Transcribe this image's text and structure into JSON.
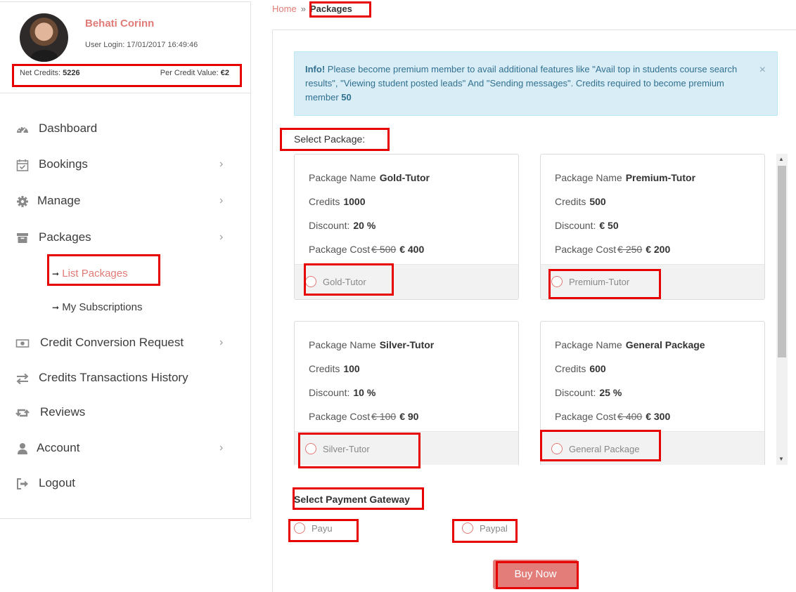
{
  "colors": {
    "accent": "#e07b77",
    "annotation": "#e60000",
    "alert_bg": "#d9edf7",
    "alert_text": "#31708f"
  },
  "profile": {
    "name": "Behati Corinn",
    "login": "User Login: 17/01/2017 16:49:46",
    "net_credits_label": "Net Credits:",
    "net_credits_value": "5226",
    "per_credit_label": "Per Credit Value:",
    "per_credit_value": "€2"
  },
  "menu": {
    "items": [
      {
        "label": "Dashboard",
        "icon": "dashboard-icon"
      },
      {
        "label": "Bookings",
        "icon": "calendar-icon"
      },
      {
        "label": "Manage",
        "icon": "gear-icon"
      },
      {
        "label": "Packages",
        "icon": "archive-icon"
      },
      {
        "label": "Credit Conversion Request",
        "icon": "money-icon"
      },
      {
        "label": "Credits Transactions History",
        "icon": "exchange-icon"
      },
      {
        "label": "Reviews",
        "icon": "retweet-icon"
      },
      {
        "label": "Account",
        "icon": "user-icon"
      },
      {
        "label": "Logout",
        "icon": "sign-out-icon"
      }
    ],
    "sub_items": [
      {
        "label": "List Packages",
        "arrow": "➞"
      },
      {
        "label": "My Subscriptions",
        "arrow": "➞"
      }
    ]
  },
  "breadcrumb": {
    "home": "Home",
    "separator": "»",
    "current": "Packages"
  },
  "alert": {
    "prefix": "Info!",
    "text": " Please become premium member to avail additional features like \"Avail top in students course search results\", \"Viewing student posted leads\" And \"Sending messages\". Credits required to become premium member ",
    "credits": "50",
    "close": "×"
  },
  "select_package_label": "Select Package:",
  "labels": {
    "package_name": "Package Name",
    "credits": "Credits",
    "discount": "Discount:",
    "package_cost": "Package Cost"
  },
  "packages": [
    {
      "name": "Gold-Tutor",
      "credits": "1000",
      "discount": "20 %",
      "old_cost": "€ 500",
      "cost": "€ 400"
    },
    {
      "name": "Premium-Tutor",
      "credits": "500",
      "discount": "€ 50",
      "old_cost": "€ 250",
      "cost": "€ 200"
    },
    {
      "name": "Silver-Tutor",
      "credits": "100",
      "discount": "10 %",
      "old_cost": "€ 100",
      "cost": "€ 90"
    },
    {
      "name": "General Package",
      "credits": "600",
      "discount": "25 %",
      "old_cost": "€ 400",
      "cost": "€ 300"
    }
  ],
  "payment": {
    "label": "Select Payment Gateway",
    "options": [
      "Payu",
      "Paypal"
    ]
  },
  "buy_button": "Buy Now"
}
